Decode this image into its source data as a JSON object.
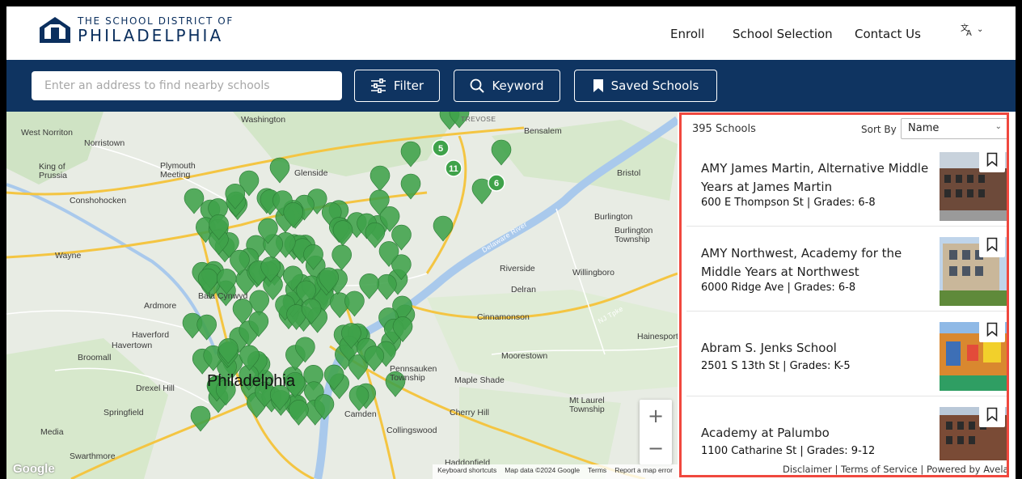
{
  "header": {
    "logo_line1": "THE SCHOOL DISTRICT OF",
    "logo_line2": "PHILADELPHIA",
    "nav": [
      "Enroll",
      "School Selection",
      "Contact Us"
    ],
    "language_icon": "translate-icon"
  },
  "search": {
    "placeholder": "Enter an address to find nearby schools",
    "filter_label": "Filter",
    "keyword_label": "Keyword",
    "saved_label": "Saved Schools"
  },
  "map": {
    "labels": [
      "West Norriton",
      "Norristown",
      "King of Prussia",
      "Plymouth Meeting",
      "Conshohocken",
      "Glenside",
      "Wayne",
      "Washington",
      "TREVOSE",
      "Bensalem",
      "Bristol",
      "Burlington",
      "Burlington Township",
      "Riverside",
      "Willingboro",
      "Delran",
      "Cinnamonson",
      "Hainesport",
      "Moorestown",
      "Pennsauken Township",
      "Maple Shade",
      "Cherry Hill",
      "Collingswood",
      "Camden",
      "Haverford",
      "Havertown",
      "Broomall",
      "Drexel Hill",
      "Springfield",
      "Media",
      "Swarthmore",
      "Ardmore",
      "Bala Cynwyd",
      "Mt Laurel Township",
      "Haddonfield",
      "Philadelphia",
      "Delaware River",
      "NJ Tpke"
    ],
    "footer": [
      "Keyboard shortcuts",
      "Map data ©2024 Google",
      "Terms",
      "Report a map error"
    ],
    "cluster_counts": [
      "5",
      "11",
      "6"
    ],
    "google_logo": "Google",
    "zoom_in": "+",
    "zoom_out": "−",
    "marker_color": "#3fa24a"
  },
  "list": {
    "count": "395 Schools",
    "sort_label": "Sort By",
    "sort_value": "Name",
    "schools": [
      {
        "name": "AMY James Martin, Alternative Middle Years at James Martin",
        "address": "600 E Thompson St | Grades: 6-8"
      },
      {
        "name": "AMY Northwest, Academy for the Middle Years at Northwest",
        "address": "6000 Ridge Ave | Grades: 6-8"
      },
      {
        "name": "Abram S. Jenks School",
        "address": "2501 S 13th St | Grades: K-5"
      },
      {
        "name": "Academy at Palumbo",
        "address": "1100 Catharine St | Grades: 9-12"
      }
    ],
    "footer": "Disclaimer  |  Terms of Service  |  Powered by Avela"
  },
  "colors": {
    "navy": "#0f3461",
    "highlight": "#f0483e"
  }
}
